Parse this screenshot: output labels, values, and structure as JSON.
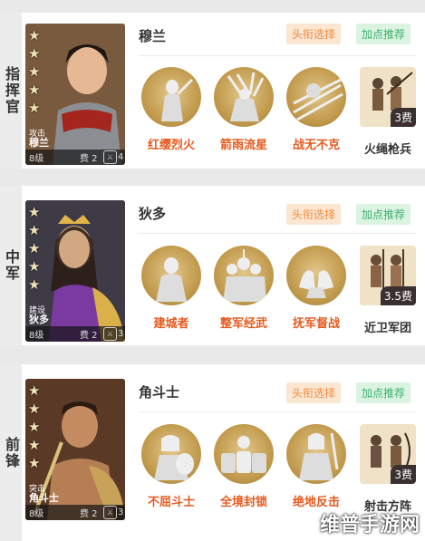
{
  "buttons": {
    "title_select": "头衔选择",
    "points_recommend": "加点推荐"
  },
  "cards": [
    {
      "role": "指挥官",
      "hero": {
        "name": "穆兰",
        "class": "攻击",
        "level": "8级",
        "cost": "费 2",
        "tp": "4",
        "stars": 5
      },
      "skills": [
        {
          "name": "红缨烈火",
          "icon": "archer-statue-icon"
        },
        {
          "name": "箭雨流星",
          "icon": "arrows-rain-icon"
        },
        {
          "name": "战无不克",
          "icon": "spears-icon"
        }
      ],
      "troop": {
        "name": "火绳枪兵",
        "cost": "3费"
      }
    },
    {
      "role": "中军",
      "hero": {
        "name": "狄多",
        "class": "建设",
        "level": "8级",
        "cost": "费 2",
        "tp": "3",
        "stars": 5
      },
      "skills": [
        {
          "name": "建城者",
          "icon": "queen-statue-icon"
        },
        {
          "name": "整军经武",
          "icon": "soldiers-icon"
        },
        {
          "name": "抚军督战",
          "icon": "hands-icon"
        }
      ],
      "troop": {
        "name": "近卫军团",
        "cost": "3.5费"
      }
    },
    {
      "role": "前锋",
      "hero": {
        "name": "角斗士",
        "class": "突击",
        "level": "8级",
        "cost": "费 2",
        "tp": "3",
        "stars": 5
      },
      "skills": [
        {
          "name": "不屈斗士",
          "icon": "gladiator-icon"
        },
        {
          "name": "全境封锁",
          "icon": "shield-wall-icon"
        },
        {
          "name": "绝地反击",
          "icon": "warrior-icon"
        }
      ],
      "troop": {
        "name": "射击方阵",
        "cost": "3费"
      }
    }
  ],
  "watermark": "维普手游网"
}
